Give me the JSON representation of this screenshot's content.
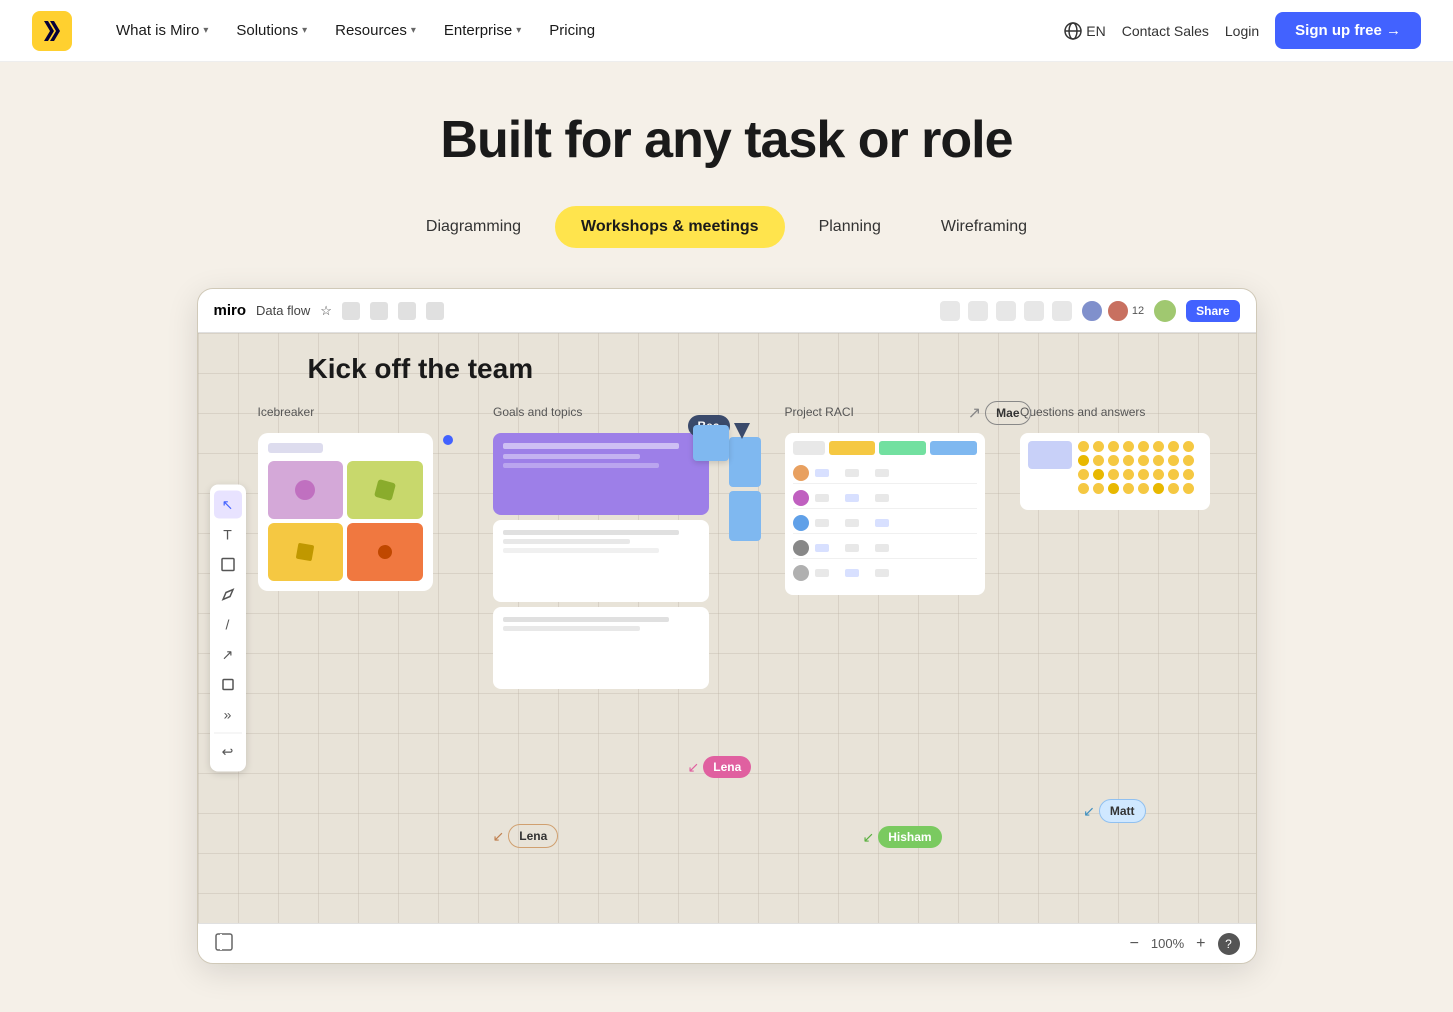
{
  "nav": {
    "logo_text": "miro",
    "links": [
      {
        "label": "What is Miro",
        "has_dropdown": true
      },
      {
        "label": "Solutions",
        "has_dropdown": true
      },
      {
        "label": "Resources",
        "has_dropdown": true
      },
      {
        "label": "Enterprise",
        "has_dropdown": true
      },
      {
        "label": "Pricing",
        "has_dropdown": false
      }
    ],
    "lang": "EN",
    "contact_sales": "Contact Sales",
    "login": "Login",
    "signup": "Sign up free →"
  },
  "hero": {
    "title": "Built for any task or role"
  },
  "tabs": [
    {
      "label": "Diagramming",
      "active": false
    },
    {
      "label": "Workshops & meetings",
      "active": true
    },
    {
      "label": "Planning",
      "active": false
    },
    {
      "label": "Wireframing",
      "active": false
    }
  ],
  "board": {
    "brand": "miro",
    "title_label": "Data flow",
    "share_label": "Share",
    "zoom_label": "100%",
    "help_label": "?",
    "board_title": "Kick off the team",
    "columns": [
      {
        "label": "Icebreaker"
      },
      {
        "label": "Goals and topics"
      },
      {
        "label": "Project RACI"
      },
      {
        "label": "Questions and answers"
      }
    ],
    "cursors": [
      {
        "name": "Bea",
        "style": "bea"
      },
      {
        "name": "Mae",
        "style": "mae"
      },
      {
        "name": "Lena",
        "style": "lena-pink"
      },
      {
        "name": "Lena",
        "style": "lena-bottom"
      },
      {
        "name": "Hisham",
        "style": "hisham"
      },
      {
        "name": "Matt",
        "style": "matt"
      }
    ]
  }
}
